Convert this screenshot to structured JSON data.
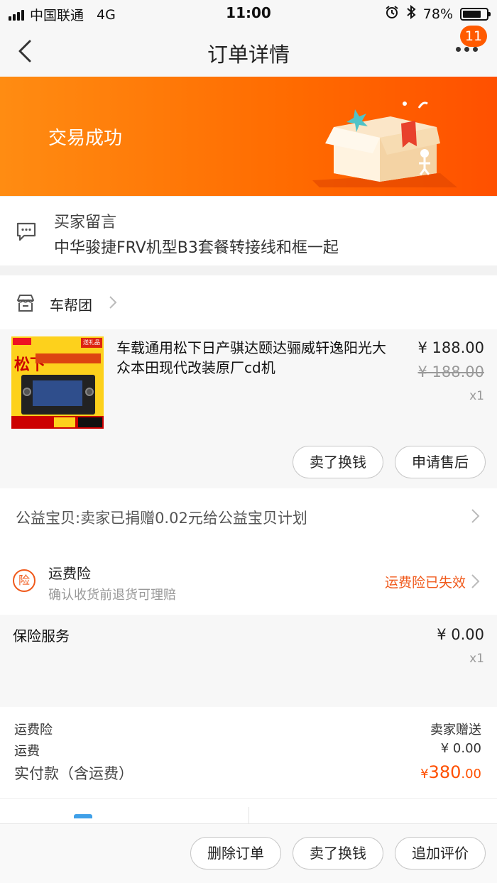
{
  "status_bar": {
    "carrier": "中国联通",
    "network": "4G",
    "time": "11:00",
    "battery_percent": "78%",
    "battery_level": 0.78
  },
  "header": {
    "title": "订单详情",
    "badge_count": "11"
  },
  "banner": {
    "status": "交易成功"
  },
  "buyer_message": {
    "label": "买家留言",
    "text": "中华骏捷FRV机型B3套餐转接线和框一起"
  },
  "store": {
    "name": "车帮团"
  },
  "product": {
    "title": "车载通用松下日产骐达颐达骊威轩逸阳光大众本田现代改装原厂cd机",
    "price": "¥ 188.00",
    "original_price": "¥ 188.00",
    "quantity": "x1",
    "thumb_text": "松下",
    "thumb_gift": "送礼品",
    "buttons": {
      "sell": "卖了换钱",
      "after_sales": "申请售后"
    }
  },
  "charity": {
    "text": "公益宝贝:卖家已捐赠0.02元给公益宝贝计划"
  },
  "shipping_insurance": {
    "title": "运费险",
    "subtitle": "确认收货前退货可理赔",
    "status": "运费险已失效"
  },
  "insurance_service": {
    "name": "保险服务",
    "price": "¥ 0.00",
    "quantity": "x1"
  },
  "summary": {
    "insurance_label": "运费险",
    "insurance_value": "卖家赠送",
    "shipping_label": "运费",
    "shipping_value": "¥ 0.00",
    "paid_label": "实付款（含运费）",
    "paid_currency": "¥",
    "paid_main": "380",
    "paid_decimal": ".00"
  },
  "bottom_bar": {
    "delete": "删除订单",
    "sell": "卖了换钱",
    "review": "追加评价"
  },
  "colors": {
    "accent": "#ff5000",
    "banner_start": "#ff8c12",
    "banner_end": "#ff5000"
  }
}
